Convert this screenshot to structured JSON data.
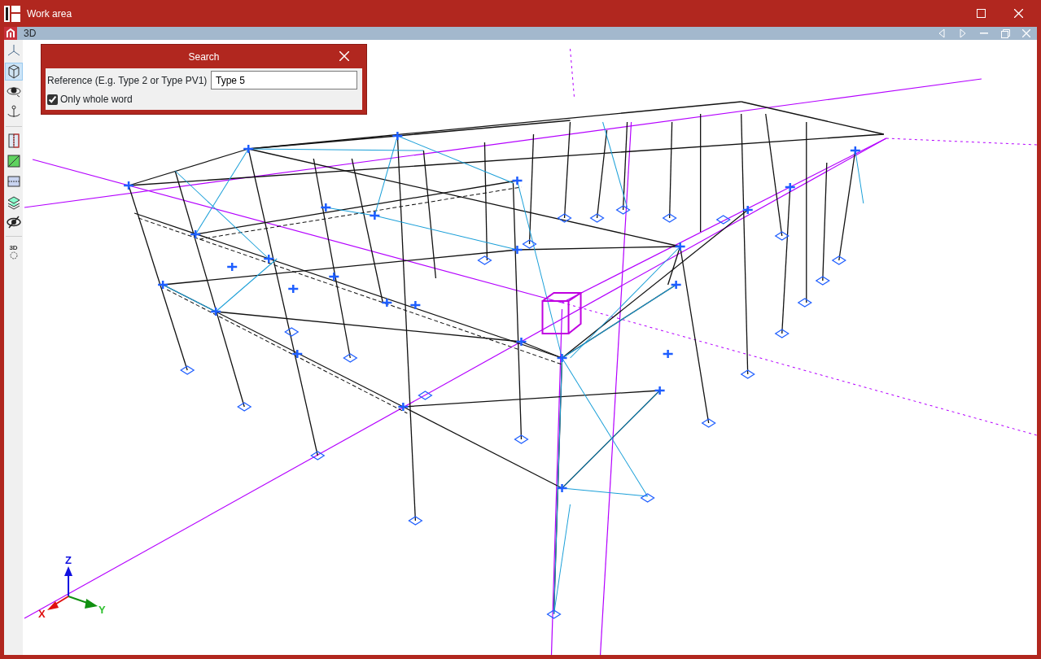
{
  "window": {
    "title": "Work area"
  },
  "view": {
    "title": "3D"
  },
  "toolbar": [
    {
      "selected": false
    },
    {
      "selected": true
    },
    {
      "selected": false
    },
    {
      "selected": false
    },
    {
      "selected": false
    },
    {
      "selected": false
    },
    {
      "selected": false
    },
    {
      "selected": false
    },
    {
      "selected": false
    },
    {
      "selected": false,
      "label": "3D"
    }
  ],
  "search": {
    "title": "Search",
    "label": "Reference (E.g. Type 2 or Type PV1)",
    "value": "Type 5",
    "option": {
      "label": "Only whole word",
      "checked": true
    }
  },
  "axes": {
    "z": "Z",
    "x": "X",
    "y": "Y"
  }
}
